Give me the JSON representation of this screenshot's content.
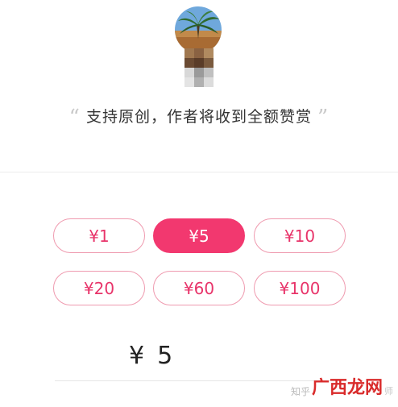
{
  "author": {
    "avatar_icon": "palm-tree-landscape-avatar",
    "name_redacted_icon": "pixelated-mosaic"
  },
  "slogan": {
    "open_quote": "“",
    "text": "支持原创，作者将收到全额赞赏",
    "close_quote": "”"
  },
  "amounts": [
    {
      "label": "¥1",
      "selected": false
    },
    {
      "label": "¥5",
      "selected": true
    },
    {
      "label": "¥10",
      "selected": false
    },
    {
      "label": "¥20",
      "selected": false
    },
    {
      "label": "¥60",
      "selected": false
    },
    {
      "label": "¥100",
      "selected": false
    }
  ],
  "custom": {
    "symbol": "¥",
    "value": "5"
  },
  "watermark": {
    "prefix": "知乎",
    "logo": "广西龙网",
    "suffix": "师"
  },
  "colors": {
    "accent": "#f2386f",
    "accent_text": "#e8346a",
    "border": "#ef9aaf"
  }
}
